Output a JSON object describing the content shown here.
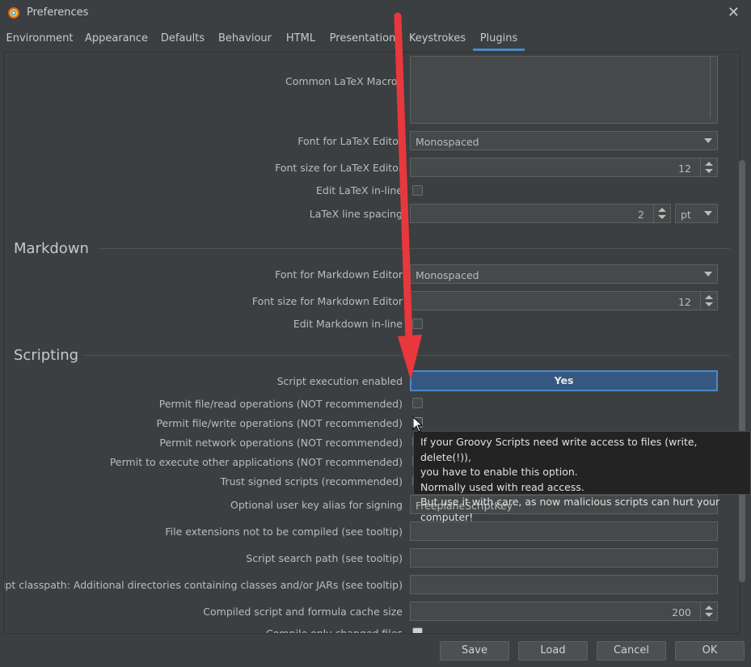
{
  "window": {
    "title": "Preferences"
  },
  "tabs": [
    "Environment",
    "Appearance",
    "Defaults",
    "Behaviour",
    "HTML",
    "Presentation",
    "Keystrokes",
    "Plugins"
  ],
  "latex": {
    "common_macros_label": "Common LaTeX Macros",
    "font_label": "Font for LaTeX Editor",
    "font_value": "Monospaced",
    "font_size_label": "Font size for LaTeX Editor",
    "font_size_value": "12",
    "inline_label": "Edit LaTeX in-line",
    "line_spacing_label": "LaTeX line spacing",
    "line_spacing_value": "2",
    "line_spacing_unit": "pt"
  },
  "markdown": {
    "section_title": "Markdown",
    "font_label": "Font for Markdown Editor",
    "font_value": "Monospaced",
    "font_size_label": "Font size for Markdown Editor",
    "font_size_value": "12",
    "inline_label": "Edit Markdown in-line"
  },
  "scripting": {
    "section_title": "Scripting",
    "exec_label": "Script execution enabled",
    "exec_value": "Yes",
    "read_label": "Permit file/read operations (NOT recommended)",
    "write_label": "Permit file/write operations (NOT recommended)",
    "network_label": "Permit network operations (NOT recommended)",
    "execute_label": "Permit to execute other applications (NOT recommended)",
    "trust_label": "Trust signed scripts (recommended)",
    "alias_label": "Optional user key alias for signing",
    "alias_value": "FreeplaneScriptKey",
    "ext_label": "File extensions not to be compiled (see tooltip)",
    "path_label": "Script search path (see tooltip)",
    "classpath_label": "Script classpath: Additional directories containing classes and/or JARs (see tooltip)",
    "cache_label": "Compiled script and formula cache size",
    "cache_value": "200",
    "compile_label": "Compile only changed files"
  },
  "tooltip": {
    "line1": "If your Groovy Scripts need write access to files (write, delete(!)),",
    "line2": "you have to enable this option.",
    "line3": "Normally used with read access.",
    "line4": "But use it with care, as now malicious scripts can hurt your computer!"
  },
  "buttons": {
    "save": "Save",
    "load": "Load",
    "cancel": "Cancel",
    "ok": "OK"
  },
  "colors": {
    "accent": "#4a88c7",
    "annotation_arrow": "#e8383d",
    "background": "#3c3f41"
  }
}
